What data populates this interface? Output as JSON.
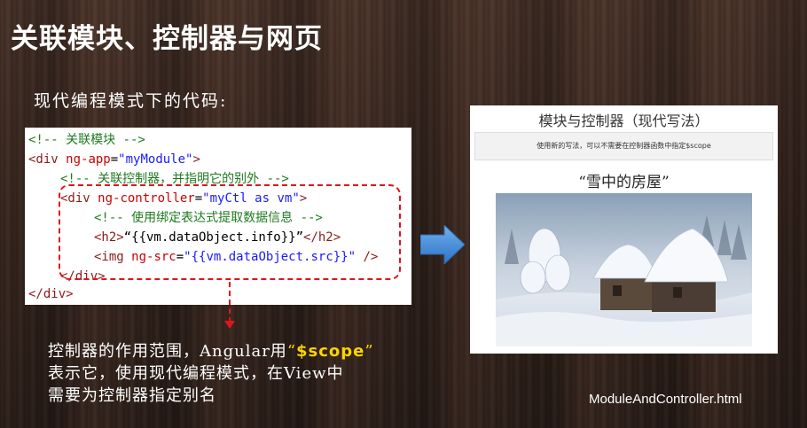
{
  "slide": {
    "title": "关联模块、控制器与网页",
    "subtitle": "现代编程模式下的代码:",
    "filename": "ModuleAndController.html"
  },
  "code": {
    "line1": "<!-- 关联模块 -->",
    "line2_tag_open": "<div ",
    "line2_attr": "ng-app",
    "line2_eq": "=",
    "line2_val": "\"myModule\"",
    "line2_close": ">",
    "line3": "<!-- 关联控制器，并指明它的别外 -->",
    "line4_tag_open": "<div ",
    "line4_attr": "ng-controller",
    "line4_eq": "=",
    "line4_val": "\"myCtl as vm\"",
    "line4_close": ">",
    "line5": "<!-- 使用绑定表达式提取数据信息 -->",
    "line6_open": "<h2>",
    "line6_text": "“{{vm.dataObject.info}}”",
    "line6_close": "</h2>",
    "line7_tag_open": "<img ",
    "line7_attr": "ng-src",
    "line7_eq": "=",
    "line7_val": "\"{{vm.dataObject.src}}\"",
    "line7_close": " />",
    "line8": "</div>",
    "line9": "</div>"
  },
  "description": {
    "part1": "控制器的作用范围，Angular用",
    "quote_open": "“",
    "scope": "$scope",
    "quote_close": "”",
    "line2": "表示它，使用现代编程模式，在View中",
    "line3": "需要为控制器指定别名"
  },
  "browser_preview": {
    "title": "模块与控制器（现代写法）",
    "info": "使用新的写法，可以不需要在控制器函数中指定$scope",
    "heading": "“雪中的房屋”"
  },
  "colors": {
    "dashed_highlight": "#e0141c",
    "scope_highlight": "#ffd400",
    "arrow": "#4a90d9"
  }
}
